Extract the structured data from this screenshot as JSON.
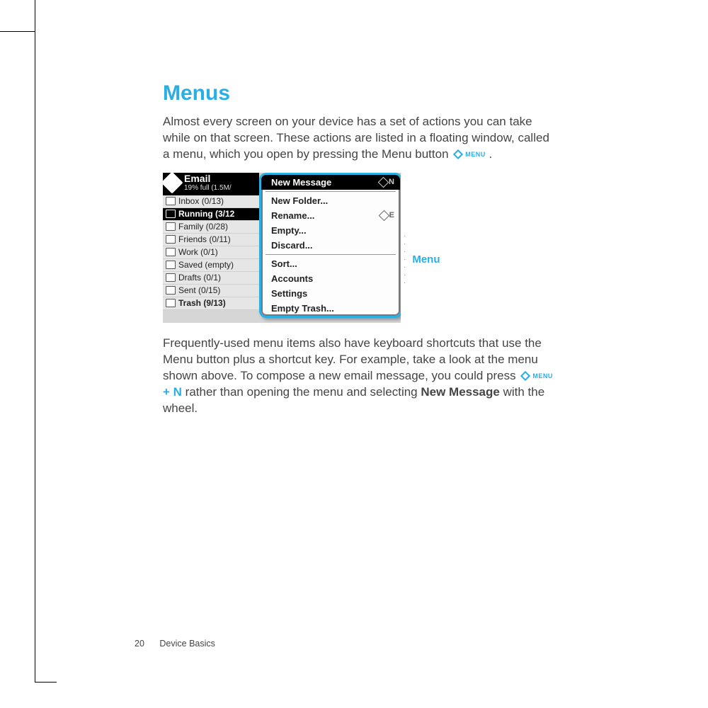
{
  "heading": "Menus",
  "para1_a": "Almost every screen on your device has a set of actions you can take while on that screen. These actions are listed in a floating window, called a menu, which you open by pressing the Menu button ",
  "menu_inline": "MENU",
  "period": ".",
  "para2_a": "Frequently-used menu items also have keyboard shortcuts that use the Menu button plus a shortcut key. For example, take a look at the menu shown above. To compose a new email message, you could press ",
  "plus_n": "+ N",
  "para2_b": " rather than opening the menu and selecting ",
  "new_message_bold": "New Message",
  "para2_c": " with the wheel.",
  "callout": "Menu",
  "screenshot": {
    "app_title": "Email",
    "app_sub": "19% full (1.5M/",
    "folders": [
      {
        "label": "Inbox (0/13)",
        "sel": false,
        "bold": false
      },
      {
        "label": "Running (3/12",
        "sel": true,
        "bold": true
      },
      {
        "label": "Family (0/28)",
        "sel": false,
        "bold": false
      },
      {
        "label": "Friends (0/11)",
        "sel": false,
        "bold": false
      },
      {
        "label": "Work (0/1)",
        "sel": false,
        "bold": false
      },
      {
        "label": "Saved (empty)",
        "sel": false,
        "bold": false
      },
      {
        "label": "Drafts (0/1)",
        "sel": false,
        "bold": false
      },
      {
        "label": "Sent (0/15)",
        "sel": false,
        "bold": false
      },
      {
        "label": "Trash (9/13)",
        "sel": false,
        "bold": true
      }
    ],
    "menu_items_top": [
      {
        "label": "New Message",
        "shortcut": "N",
        "first": true
      }
    ],
    "menu_items_mid": [
      {
        "label": "New Folder...",
        "shortcut": ""
      },
      {
        "label": "Rename...",
        "shortcut": "E"
      },
      {
        "label": "Empty...",
        "shortcut": ""
      },
      {
        "label": "Discard...",
        "shortcut": ""
      }
    ],
    "menu_items_bot": [
      {
        "label": "Sort...",
        "shortcut": ""
      },
      {
        "label": "Accounts",
        "shortcut": ""
      },
      {
        "label": "Settings",
        "shortcut": ""
      },
      {
        "label": "Empty Trash...",
        "shortcut": ""
      }
    ]
  },
  "footer": {
    "page": "20",
    "section": "Device Basics"
  }
}
